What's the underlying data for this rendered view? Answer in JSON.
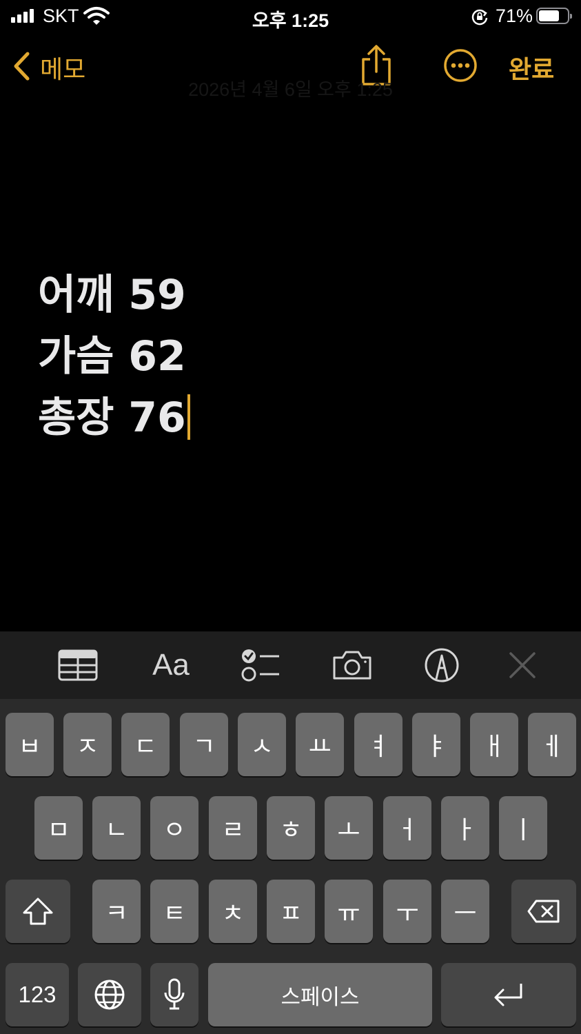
{
  "status_bar": {
    "carrier": "SKT",
    "time": "오후 1:25",
    "battery_percent": "71%",
    "battery_level": 0.71
  },
  "nav": {
    "back_label": "메모",
    "done_label": "완료",
    "faint_date": "2026년 4월 6일 오후 1:25"
  },
  "note": {
    "lines": [
      "어깨 59",
      "가슴 62",
      "총장 76"
    ]
  },
  "toolbar": {
    "items": [
      "table-icon",
      "Aa",
      "checklist-icon",
      "camera-icon",
      "markup-icon",
      "close-icon"
    ],
    "format_label": "Aa"
  },
  "keyboard": {
    "row1": [
      "ㅂ",
      "ㅈ",
      "ㄷ",
      "ㄱ",
      "ㅅ",
      "ㅛ",
      "ㅕ",
      "ㅑ",
      "ㅐ",
      "ㅔ"
    ],
    "row2": [
      "ㅁ",
      "ㄴ",
      "ㅇ",
      "ㄹ",
      "ㅎ",
      "ㅗ",
      "ㅓ",
      "ㅏ",
      "ㅣ"
    ],
    "row3": [
      "ㅋ",
      "ㅌ",
      "ㅊ",
      "ㅍ",
      "ㅠ",
      "ㅜ",
      "ㅡ"
    ],
    "numbers_label": "123",
    "space_label": "스페이스"
  },
  "colors": {
    "accent": "#e2a931",
    "background": "#000000",
    "toolbar": "#1e1e1e",
    "keyboard": "#2b2b2b",
    "key": "#6b6b6b",
    "key_dark": "#464646"
  }
}
